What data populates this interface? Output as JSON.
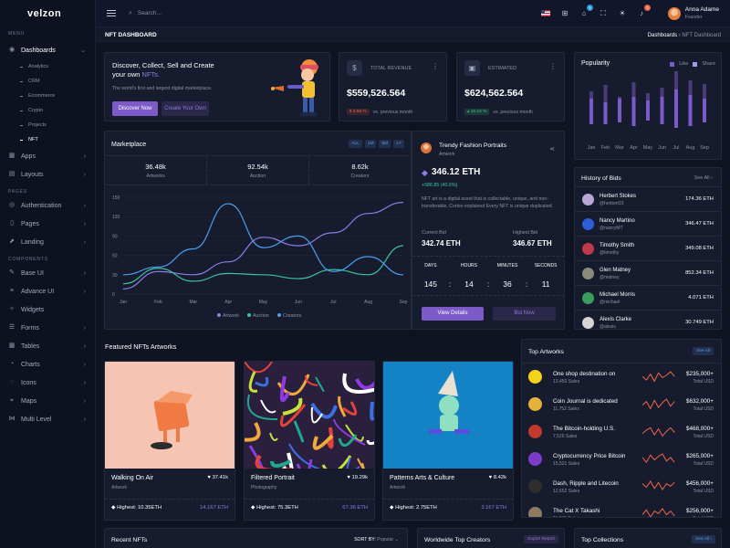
{
  "brand": {
    "logo": "velzon"
  },
  "sidebar": {
    "menu_title": "MENU",
    "dashboards": {
      "label": "Dashboards",
      "subs": [
        "Analytics",
        "CRM",
        "Ecommerce",
        "Crypto",
        "Projects",
        "NFT"
      ]
    },
    "items1": [
      "Apps",
      "Layouts"
    ],
    "pages_title": "PAGES",
    "items2": [
      "Authentication",
      "Pages",
      "Landing"
    ],
    "components_title": "COMPONENTS",
    "items3": [
      "Base UI",
      "Advance UI",
      "Widgets",
      "Forms",
      "Tables",
      "Charts",
      "Icons",
      "Maps",
      "Multi Level"
    ]
  },
  "topbar": {
    "search_placeholder": "Search...",
    "cart_badge": "5",
    "notif_badge": "3",
    "user_name": "Anna Adame",
    "user_role": "Founder"
  },
  "page": {
    "title": "NFT DASHBOARD",
    "crumb_root": "Dashboards",
    "crumb_current": "NFT Dashboard"
  },
  "hero": {
    "title_line1": "Discover, Collect, Sell and Create",
    "title_line2": "your own ",
    "title_highlight": "NFTs.",
    "subtitle": "The world's first and largest digital marketplace.",
    "btn_discover": "Discover Now",
    "btn_create": "Create Your Own"
  },
  "revenue": {
    "label": "TOTAL REVENUE",
    "value": "$559,526.564",
    "change": "3.96 %",
    "note": "vs. previous month"
  },
  "estimated": {
    "label": "ESTIMATED",
    "value": "$624,562.564",
    "change": "16.24 %",
    "note": "vs. previous month"
  },
  "popularity": {
    "title": "Popularity",
    "legend_like": "Like",
    "legend_share": "Share",
    "months": [
      "Jan",
      "Feb",
      "Mar",
      "Apr",
      "May",
      "Jun",
      "Jul",
      "Aug",
      "Sep"
    ]
  },
  "marketplace": {
    "title": "Marketplace",
    "filters": [
      "ALL",
      "1M",
      "6M",
      "1Y"
    ],
    "stats": [
      {
        "value": "36.48k",
        "label": "Artworks"
      },
      {
        "value": "92.54k",
        "label": "Auction"
      },
      {
        "value": "8.62k",
        "label": "Creators"
      }
    ]
  },
  "chart_data": {
    "type": "line",
    "x": [
      "Jan",
      "Feb",
      "Mar",
      "Apr",
      "May",
      "Jun",
      "Jul",
      "Aug",
      "Sep"
    ],
    "ylim": [
      0,
      150
    ],
    "yticks": [
      0,
      30,
      60,
      90,
      120,
      150
    ],
    "series": [
      {
        "name": "Artwork",
        "color": "#8f7ce6",
        "values": [
          8,
          35,
          30,
          50,
          88,
          75,
          95,
          125,
          142
        ]
      },
      {
        "name": "Auction",
        "color": "#3dc2a0",
        "values": [
          16,
          40,
          20,
          32,
          30,
          24,
          38,
          30,
          75
        ]
      },
      {
        "name": "Creators",
        "color": "#4b9ff0",
        "values": [
          30,
          42,
          70,
          140,
          72,
          90,
          35,
          58,
          30
        ]
      }
    ]
  },
  "trending": {
    "title": "Trendy Fashion Portraits",
    "subtitle": "Artwork",
    "price": "346.12 ETH",
    "change": "+586.85 (40.6%)",
    "desc": "NFT art is a digital asset that is collectable, unique, and non-transferable, Cortes explained Every NFT is unique duplicated.",
    "current_bid_label": "Current Bid",
    "current_bid": "342.74 ETH",
    "highest_bid_label": "Highest Bid",
    "highest_bid": "346.67 ETH",
    "timer_labels": [
      "DAYS",
      "HOURS",
      "MINUTES",
      "SECONDS"
    ],
    "timer_values": [
      "145",
      "14",
      "36",
      "11"
    ],
    "btn_details": "View Details",
    "btn_bid": "Bid Now"
  },
  "history": {
    "title": "History of Bids",
    "see_all": "See All",
    "rows": [
      {
        "name": "Herbert Stokes",
        "handle": "@herbert10",
        "value": "174.36 ETH",
        "color": "#b9a7d6"
      },
      {
        "name": "Nancy Martino",
        "handle": "@nancyMT",
        "value": "346.47 ETH",
        "color": "#2c5fd9"
      },
      {
        "name": "Timothy Smith",
        "handle": "@timothy",
        "value": "349.08 ETH",
        "color": "#c0394a"
      },
      {
        "name": "Glen Matney",
        "handle": "@matney",
        "value": "852.34 ETH",
        "color": "#8a8a7a"
      },
      {
        "name": "Michael Morris",
        "handle": "@michael",
        "value": "4.071 ETH",
        "color": "#3b9d5b"
      },
      {
        "name": "Alexis Clarke",
        "handle": "@alexis",
        "value": "30.749 ETH",
        "color": "#d8d4d2"
      }
    ]
  },
  "featured": {
    "title": "Featured NFTs Artworks",
    "items": [
      {
        "name": "Walking On Air",
        "likes": "37.41k",
        "category": "Artwork",
        "highest_label": "Highest: 10.35ETH",
        "price": "14.167 ETH"
      },
      {
        "name": "Filtered Portrait",
        "likes": "19.29k",
        "category": "Photography",
        "highest_label": "Highest: 75.3ETH",
        "price": "67.36 ETH"
      },
      {
        "name": "Patterns Arts & Culture",
        "likes": "8.42k",
        "category": "Artwork",
        "highest_label": "Highest: 2.75ETH",
        "price": "3.167 ETH"
      }
    ]
  },
  "top_artworks": {
    "title": "Top Artworks",
    "see_all": "See All",
    "rows": [
      {
        "name": "One shop destination on",
        "sales": "13,450 Sales",
        "value": "$235,000+",
        "sub": "Total USD",
        "color": "#f5d11b"
      },
      {
        "name": "Coin Journal is dedicated",
        "sales": "11,752 Sales",
        "value": "$632,000+",
        "sub": "Total USD",
        "color": "#e3b23c"
      },
      {
        "name": "The Bitcoin-holding U.S.",
        "sales": "7,526 Sales",
        "value": "$468,000+",
        "sub": "Total USD",
        "color": "#c0392b"
      },
      {
        "name": "Cryptocurrency Price Bitcoin",
        "sales": "15,521 Sales",
        "value": "$265,000+",
        "sub": "Total USD",
        "color": "#7d3cc8"
      },
      {
        "name": "Dash, Ripple and Litecoin",
        "sales": "12,652 Sales",
        "value": "$456,000+",
        "sub": "Total USD",
        "color": "#2e2e2e"
      },
      {
        "name": "The Cat X Takashi",
        "sales": "11,745 Sales",
        "value": "$256,000+",
        "sub": "Total USD",
        "color": "#8c7b60"
      }
    ]
  },
  "bottom": {
    "recent": "Recent NFTs",
    "sort_label": "SORT BY:",
    "sort_value": "Popular",
    "creators": "Worldwide Top Creators",
    "export": "Export Report",
    "collections": "Top Collections",
    "see_all": "See All"
  }
}
